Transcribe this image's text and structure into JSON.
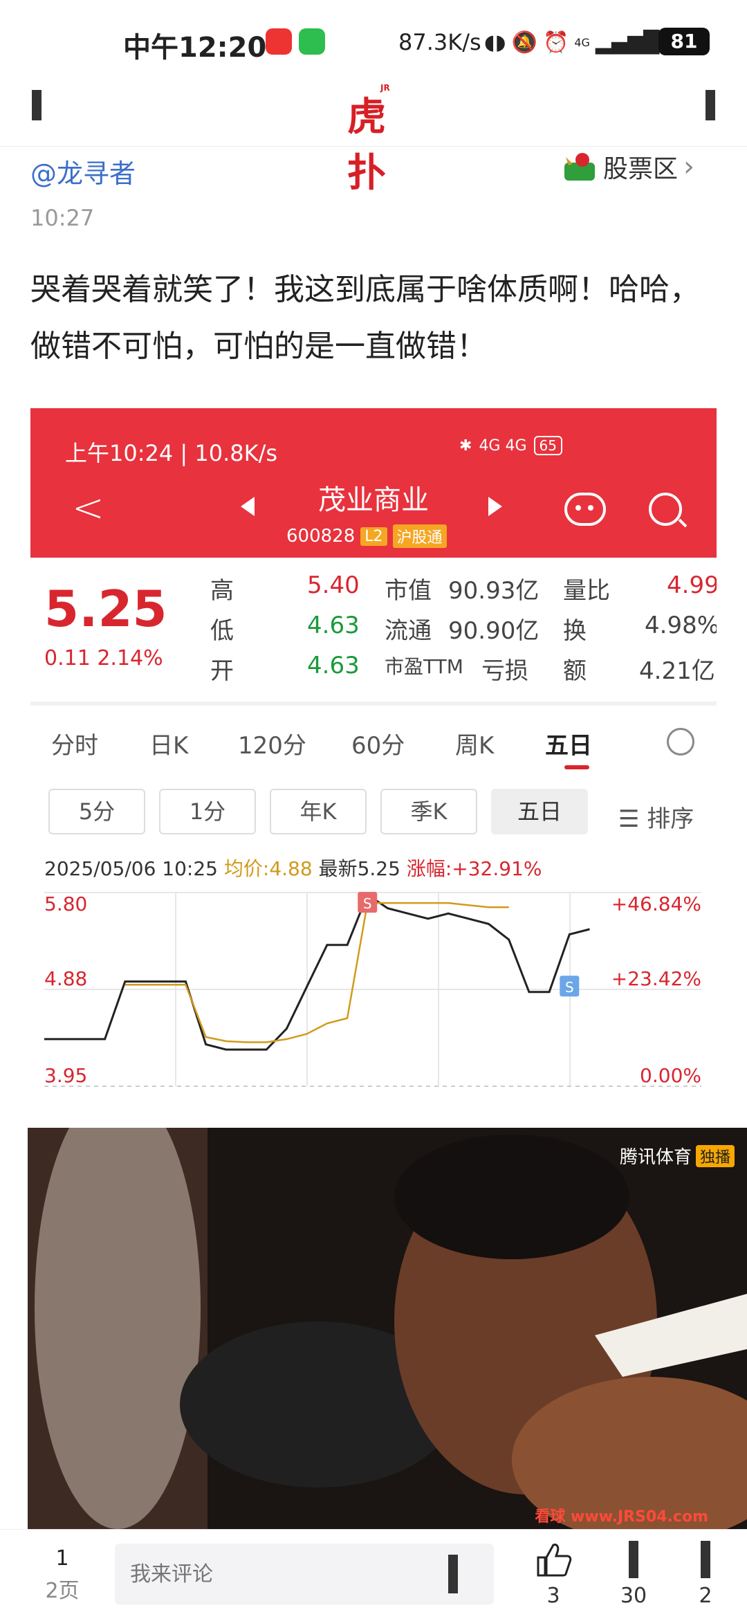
{
  "status_bar": {
    "time": "中午12:20",
    "speed": "87.3K/s",
    "network": "4G",
    "battery": "81"
  },
  "header": {
    "logo": "虎扑",
    "logo_sub": "JR"
  },
  "post": {
    "author": "@龙寻者",
    "section_label": "股票区",
    "time": "10:27",
    "body": "哭着哭着就笑了！我这到底属于啥体质啊！哈哈，做错不可怕，可怕的是一直做错！"
  },
  "embedded": {
    "status_time": "上午10:24 | 10.8K/s",
    "status_right": "4G 4G",
    "battery": "65",
    "stock_name": "茂业商业",
    "stock_code": "600828",
    "tag_l2": "L2",
    "tag_hgt": "沪股通",
    "price": "5.25",
    "change": "0.11  2.14%",
    "quote": {
      "high_label": "高",
      "high": "5.40",
      "low_label": "低",
      "low": "4.63",
      "open_label": "开",
      "open": "4.63",
      "mcap_label": "市值",
      "mcap": "90.93亿",
      "float_label": "流通",
      "float": "90.90亿",
      "pe_label": "市盈TTM",
      "pe": "亏损",
      "vr_label": "量比",
      "vr": "4.99",
      "turn_label": "换",
      "turn": "4.98%",
      "amt_label": "额",
      "amt": "4.21亿"
    },
    "tabs": [
      "分时",
      "日K",
      "120分",
      "60分",
      "周K",
      "五日"
    ],
    "active_tab": "五日",
    "chips": [
      "5分",
      "1分",
      "年K",
      "季K",
      "五日"
    ],
    "sort_label": "排序",
    "chart_info": {
      "datetime": "2025/05/06 10:25",
      "avg": "均价:4.88",
      "latest": "最新5.25",
      "change": "涨幅:+32.91%"
    }
  },
  "chart_data": {
    "type": "line",
    "title": "",
    "y_labels_left": [
      "5.80",
      "4.88",
      "3.95"
    ],
    "y_labels_right": [
      "+46.84%",
      "+23.42%",
      "0.00%"
    ],
    "ylim": [
      3.95,
      5.8
    ],
    "markers": [
      "S",
      "S"
    ],
    "series": [
      {
        "name": "",
        "values": [
          4.4,
          4.4,
          4.4,
          4.4,
          4.95,
          4.95,
          4.95,
          4.95,
          4.35,
          4.3,
          4.3,
          4.3,
          4.5,
          4.9,
          5.3,
          5.3,
          5.78,
          5.65,
          5.6,
          5.55,
          5.6,
          5.55,
          5.5,
          5.35,
          4.85,
          4.85,
          5.4,
          5.45
        ]
      },
      {
        "name": "",
        "values": [
          null,
          null,
          null,
          null,
          4.92,
          4.92,
          4.92,
          4.92,
          4.42,
          4.38,
          4.37,
          4.37,
          4.4,
          4.45,
          4.55,
          4.6,
          5.7,
          5.7,
          5.7,
          5.7,
          5.7,
          5.68,
          5.66,
          5.66,
          null,
          null,
          null,
          null
        ]
      }
    ]
  },
  "video": {
    "watermark": "腾讯体育",
    "watermark_tag": "独播",
    "url": "看球 www.JRS04.com"
  },
  "bottom_bar": {
    "page_current": "1",
    "page_total": "2页",
    "comment_placeholder": "我来评论",
    "likes": "3",
    "count2": "30",
    "count3": "2"
  }
}
